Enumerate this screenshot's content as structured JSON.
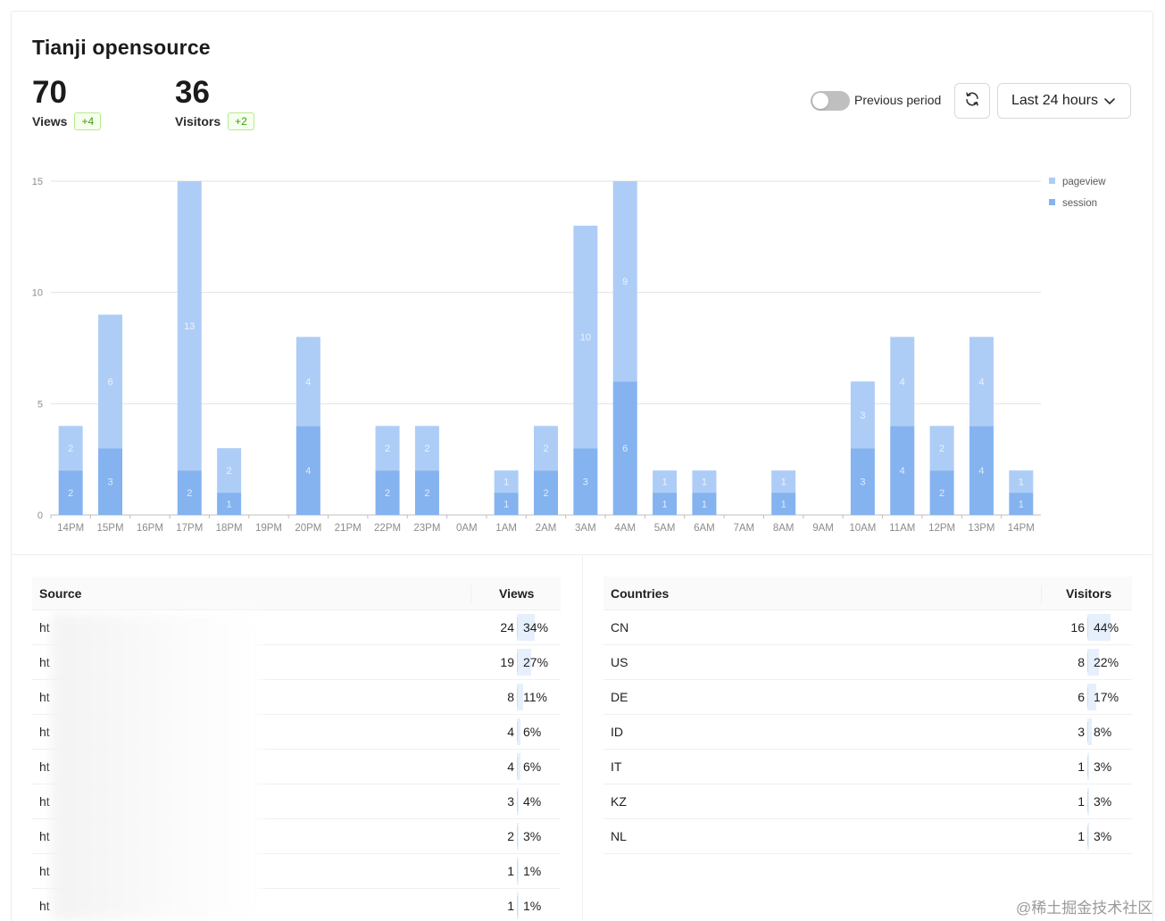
{
  "header": {
    "title": "Tianji opensource",
    "views": {
      "value": "70",
      "label": "Views",
      "delta": "+4"
    },
    "visitors": {
      "value": "36",
      "label": "Visitors",
      "delta": "+2"
    }
  },
  "controls": {
    "previous_period_label": "Previous period",
    "previous_period_on": false,
    "range_label": "Last 24 hours",
    "refresh_icon": "refresh-icon",
    "chevron_icon": "chevron-down-icon"
  },
  "colors": {
    "pageview": "#aecdf6",
    "session": "#84b3ef",
    "accent_green": "#389e0d"
  },
  "chart_data": {
    "type": "bar",
    "stacked": true,
    "categories": [
      "14PM",
      "15PM",
      "16PM",
      "17PM",
      "18PM",
      "19PM",
      "20PM",
      "21PM",
      "22PM",
      "23PM",
      "0AM",
      "1AM",
      "2AM",
      "3AM",
      "4AM",
      "5AM",
      "6AM",
      "7AM",
      "8AM",
      "9AM",
      "10AM",
      "11AM",
      "12PM",
      "13PM",
      "14PM"
    ],
    "series": [
      {
        "name": "session",
        "values": [
          2,
          3,
          0,
          2,
          1,
          0,
          4,
          0,
          2,
          2,
          0,
          1,
          2,
          3,
          6,
          1,
          1,
          0,
          1,
          0,
          3,
          4,
          2,
          4,
          1
        ]
      },
      {
        "name": "pageview",
        "values": [
          2,
          6,
          0,
          13,
          2,
          0,
          4,
          0,
          2,
          2,
          0,
          1,
          2,
          10,
          9,
          1,
          1,
          0,
          1,
          0,
          3,
          4,
          2,
          4,
          1
        ]
      }
    ],
    "yticks": [
      0,
      5,
      10,
      15
    ],
    "ylim": [
      0,
      15
    ],
    "legend": "top-right",
    "grid": true
  },
  "source_table": {
    "col_source": "Source",
    "col_views": "Views",
    "rows": [
      {
        "source": "ht",
        "count": "24",
        "percent": "34%",
        "ratio": 0.34
      },
      {
        "source": "ht",
        "count": "19",
        "percent": "27%",
        "ratio": 0.27
      },
      {
        "source": "ht",
        "count": "8",
        "percent": "11%",
        "ratio": 0.11
      },
      {
        "source": "ht",
        "count": "4",
        "percent": "6%",
        "ratio": 0.06
      },
      {
        "source": "ht",
        "count": "4",
        "percent": "6%",
        "ratio": 0.06
      },
      {
        "source": "ht",
        "count": "3",
        "percent": "4%",
        "ratio": 0.04
      },
      {
        "source": "ht",
        "count": "2",
        "percent": "3%",
        "ratio": 0.03
      },
      {
        "source": "ht",
        "count": "1",
        "percent": "1%",
        "ratio": 0.01
      },
      {
        "source": "ht",
        "count": "1",
        "percent": "1%",
        "ratio": 0.01
      }
    ]
  },
  "countries_table": {
    "col_country": "Countries",
    "col_visitors": "Visitors",
    "rows": [
      {
        "country": "CN",
        "count": "16",
        "percent": "44%",
        "ratio": 0.44
      },
      {
        "country": "US",
        "count": "8",
        "percent": "22%",
        "ratio": 0.22
      },
      {
        "country": "DE",
        "count": "6",
        "percent": "17%",
        "ratio": 0.17
      },
      {
        "country": "ID",
        "count": "3",
        "percent": "8%",
        "ratio": 0.08
      },
      {
        "country": "IT",
        "count": "1",
        "percent": "3%",
        "ratio": 0.03
      },
      {
        "country": "KZ",
        "count": "1",
        "percent": "3%",
        "ratio": 0.03
      },
      {
        "country": "NL",
        "count": "1",
        "percent": "3%",
        "ratio": 0.03
      }
    ]
  },
  "watermark": "@稀土掘金技术社区"
}
